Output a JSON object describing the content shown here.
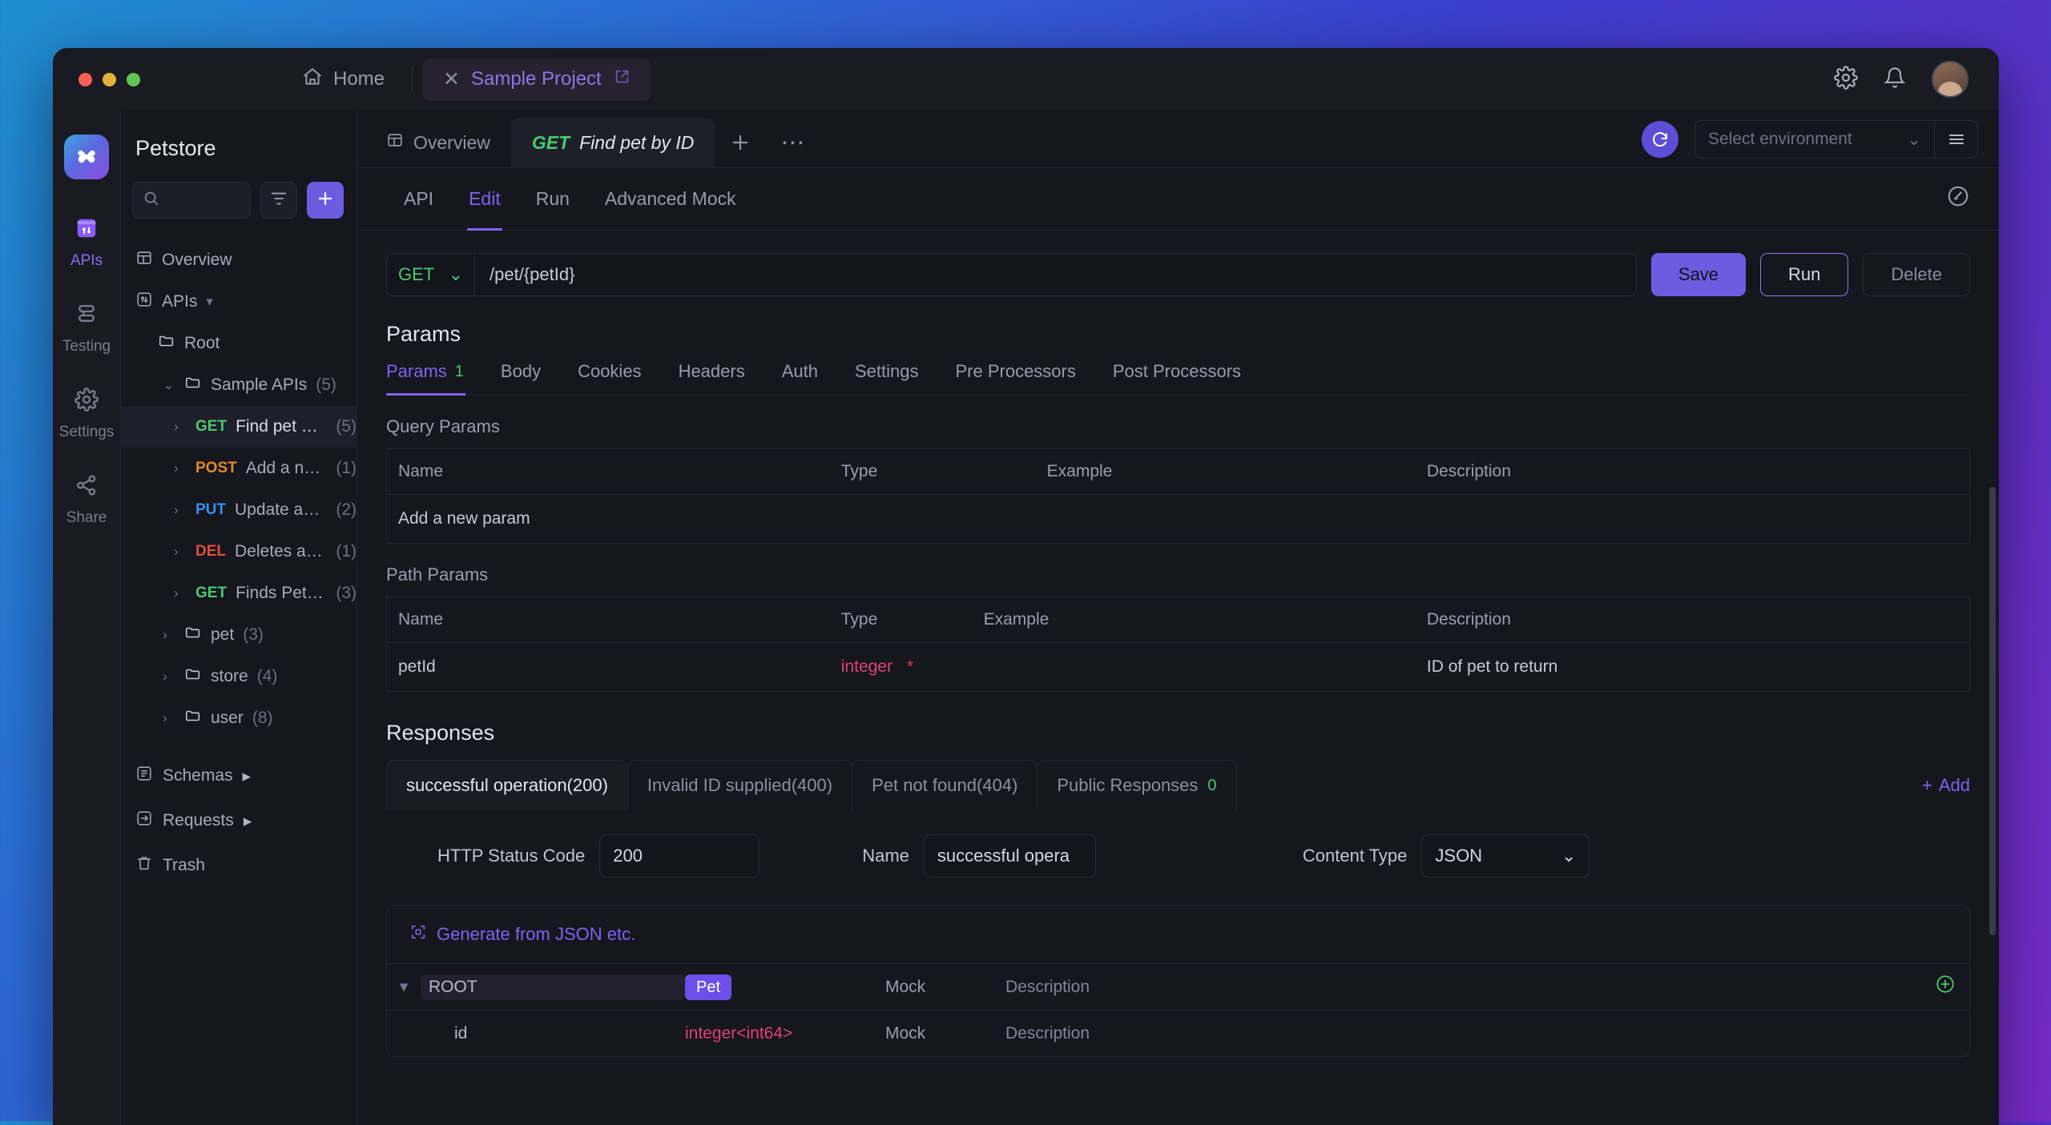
{
  "titlebar": {
    "home_tab": "Home",
    "home_icon": "home-icon",
    "project_tab": "Sample Project",
    "project_close_icon": "close-icon",
    "project_external_icon": "external-link-icon",
    "settings_icon": "gear-icon",
    "notifications_icon": "bell-icon",
    "avatar": "user-avatar"
  },
  "rail": {
    "logo": "apidog-logo",
    "items": [
      {
        "label": "APIs",
        "icon": "apis-icon",
        "active": true
      },
      {
        "label": "Testing",
        "icon": "testing-icon",
        "active": false
      },
      {
        "label": "Settings",
        "icon": "settings-icon",
        "active": false
      },
      {
        "label": "Share",
        "icon": "share-icon",
        "active": false
      }
    ]
  },
  "panel": {
    "title": "Petstore",
    "search_placeholder": "",
    "search_icon": "search-icon",
    "filter_icon": "filter-icon",
    "add_icon": "plus-icon",
    "overview": "Overview",
    "apis_label": "APIs",
    "tree": [
      {
        "type": "folder",
        "label": "Root",
        "count": "",
        "indent": 1,
        "caret": ""
      },
      {
        "type": "folder",
        "label": "Sample APIs",
        "count": "(5)",
        "indent": 2,
        "caret": "down"
      },
      {
        "type": "api",
        "method": "GET",
        "label": "Find pet by ID",
        "count": "(5)",
        "indent": 3,
        "caret": "right",
        "selected": true
      },
      {
        "type": "api",
        "method": "POST",
        "label": "Add a new pet to th...",
        "count": "(1)",
        "indent": 3,
        "caret": "right",
        "selected": false
      },
      {
        "type": "api",
        "method": "PUT",
        "label": "Update an existing p...",
        "count": "(2)",
        "indent": 3,
        "caret": "right",
        "selected": false
      },
      {
        "type": "api",
        "method": "DEL",
        "label": "Deletes a pet",
        "count": "(1)",
        "indent": 3,
        "caret": "right",
        "selected": false
      },
      {
        "type": "api",
        "method": "GET",
        "label": "Finds Pets by status",
        "count": "(3)",
        "indent": 3,
        "caret": "right",
        "selected": false
      },
      {
        "type": "folder",
        "label": "pet",
        "count": "(3)",
        "indent": 2,
        "caret": "right"
      },
      {
        "type": "folder",
        "label": "store",
        "count": "(4)",
        "indent": 2,
        "caret": "right"
      },
      {
        "type": "folder",
        "label": "user",
        "count": "(8)",
        "indent": 2,
        "caret": "right"
      }
    ],
    "sections": [
      {
        "label": "Schemas",
        "icon": "schemas-icon"
      },
      {
        "label": "Requests",
        "icon": "requests-icon"
      },
      {
        "label": "Trash",
        "icon": "trash-icon"
      }
    ]
  },
  "main_tabs": {
    "overview": "Overview",
    "overview_icon": "overview-icon",
    "active_method": "GET",
    "active_title": "Find pet by ID",
    "add_icon": "plus-icon",
    "more_icon": "ellipsis-icon",
    "refresh_icon": "refresh-icon",
    "env_placeholder": "Select environment",
    "env_chevron": "chevron-down-icon",
    "env_menu_icon": "hamburger-icon"
  },
  "sub_tabs": {
    "items": [
      "API",
      "Edit",
      "Run",
      "Advanced Mock"
    ],
    "active": "Edit",
    "edit_icon": "edit-pencil-icon"
  },
  "url_bar": {
    "method": "GET",
    "method_chevron": "chevron-down-icon",
    "path": "/pet/{petId}",
    "save_label": "Save",
    "run_label": "Run",
    "delete_label": "Delete"
  },
  "params": {
    "heading": "Params",
    "tabs": [
      {
        "label": "Params",
        "badge": "1",
        "active": true
      },
      {
        "label": "Body",
        "badge": "",
        "active": false
      },
      {
        "label": "Cookies",
        "badge": "",
        "active": false
      },
      {
        "label": "Headers",
        "badge": "",
        "active": false
      },
      {
        "label": "Auth",
        "badge": "",
        "active": false
      },
      {
        "label": "Settings",
        "badge": "",
        "active": false
      },
      {
        "label": "Pre Processors",
        "badge": "",
        "active": false
      },
      {
        "label": "Post Processors",
        "badge": "",
        "active": false
      }
    ],
    "query_heading": "Query Params",
    "query_columns": [
      "Name",
      "Type",
      "Example",
      "Description"
    ],
    "query_placeholder": "Add a new param",
    "path_heading": "Path Params",
    "path_columns": [
      "Name",
      "Type",
      "Example",
      "Description"
    ],
    "path_rows": [
      {
        "name": "petId",
        "type": "integer",
        "required": "*",
        "example": "",
        "description": "ID of pet to return"
      }
    ]
  },
  "responses": {
    "heading": "Responses",
    "tabs": [
      {
        "label": "successful operation(200)",
        "badge": "",
        "active": true
      },
      {
        "label": "Invalid ID supplied(400)",
        "badge": "",
        "active": false
      },
      {
        "label": "Pet not found(404)",
        "badge": "",
        "active": false
      },
      {
        "label": "Public Responses",
        "badge": "0",
        "active": false
      }
    ],
    "add_label": "Add",
    "add_icon": "plus-icon",
    "status_label": "HTTP Status Code",
    "status_value": "200",
    "name_label": "Name",
    "name_value": "successful opera",
    "content_type_label": "Content Type",
    "content_type_value": "JSON",
    "content_type_chevron": "chevron-down-icon",
    "generate_label": "Generate from JSON etc.",
    "generate_icon": "generate-icon",
    "schema_rows": [
      {
        "name": "ROOT",
        "type": "Pet",
        "type_style": "pill",
        "mock": "Mock",
        "description": "Description",
        "caret": "down",
        "indent": 0,
        "action": "plus-circle-icon"
      },
      {
        "name": "id",
        "type": "integer<int64>",
        "type_style": "text",
        "mock": "Mock",
        "description": "Description",
        "caret": "",
        "indent": 1,
        "action": ""
      }
    ]
  }
}
